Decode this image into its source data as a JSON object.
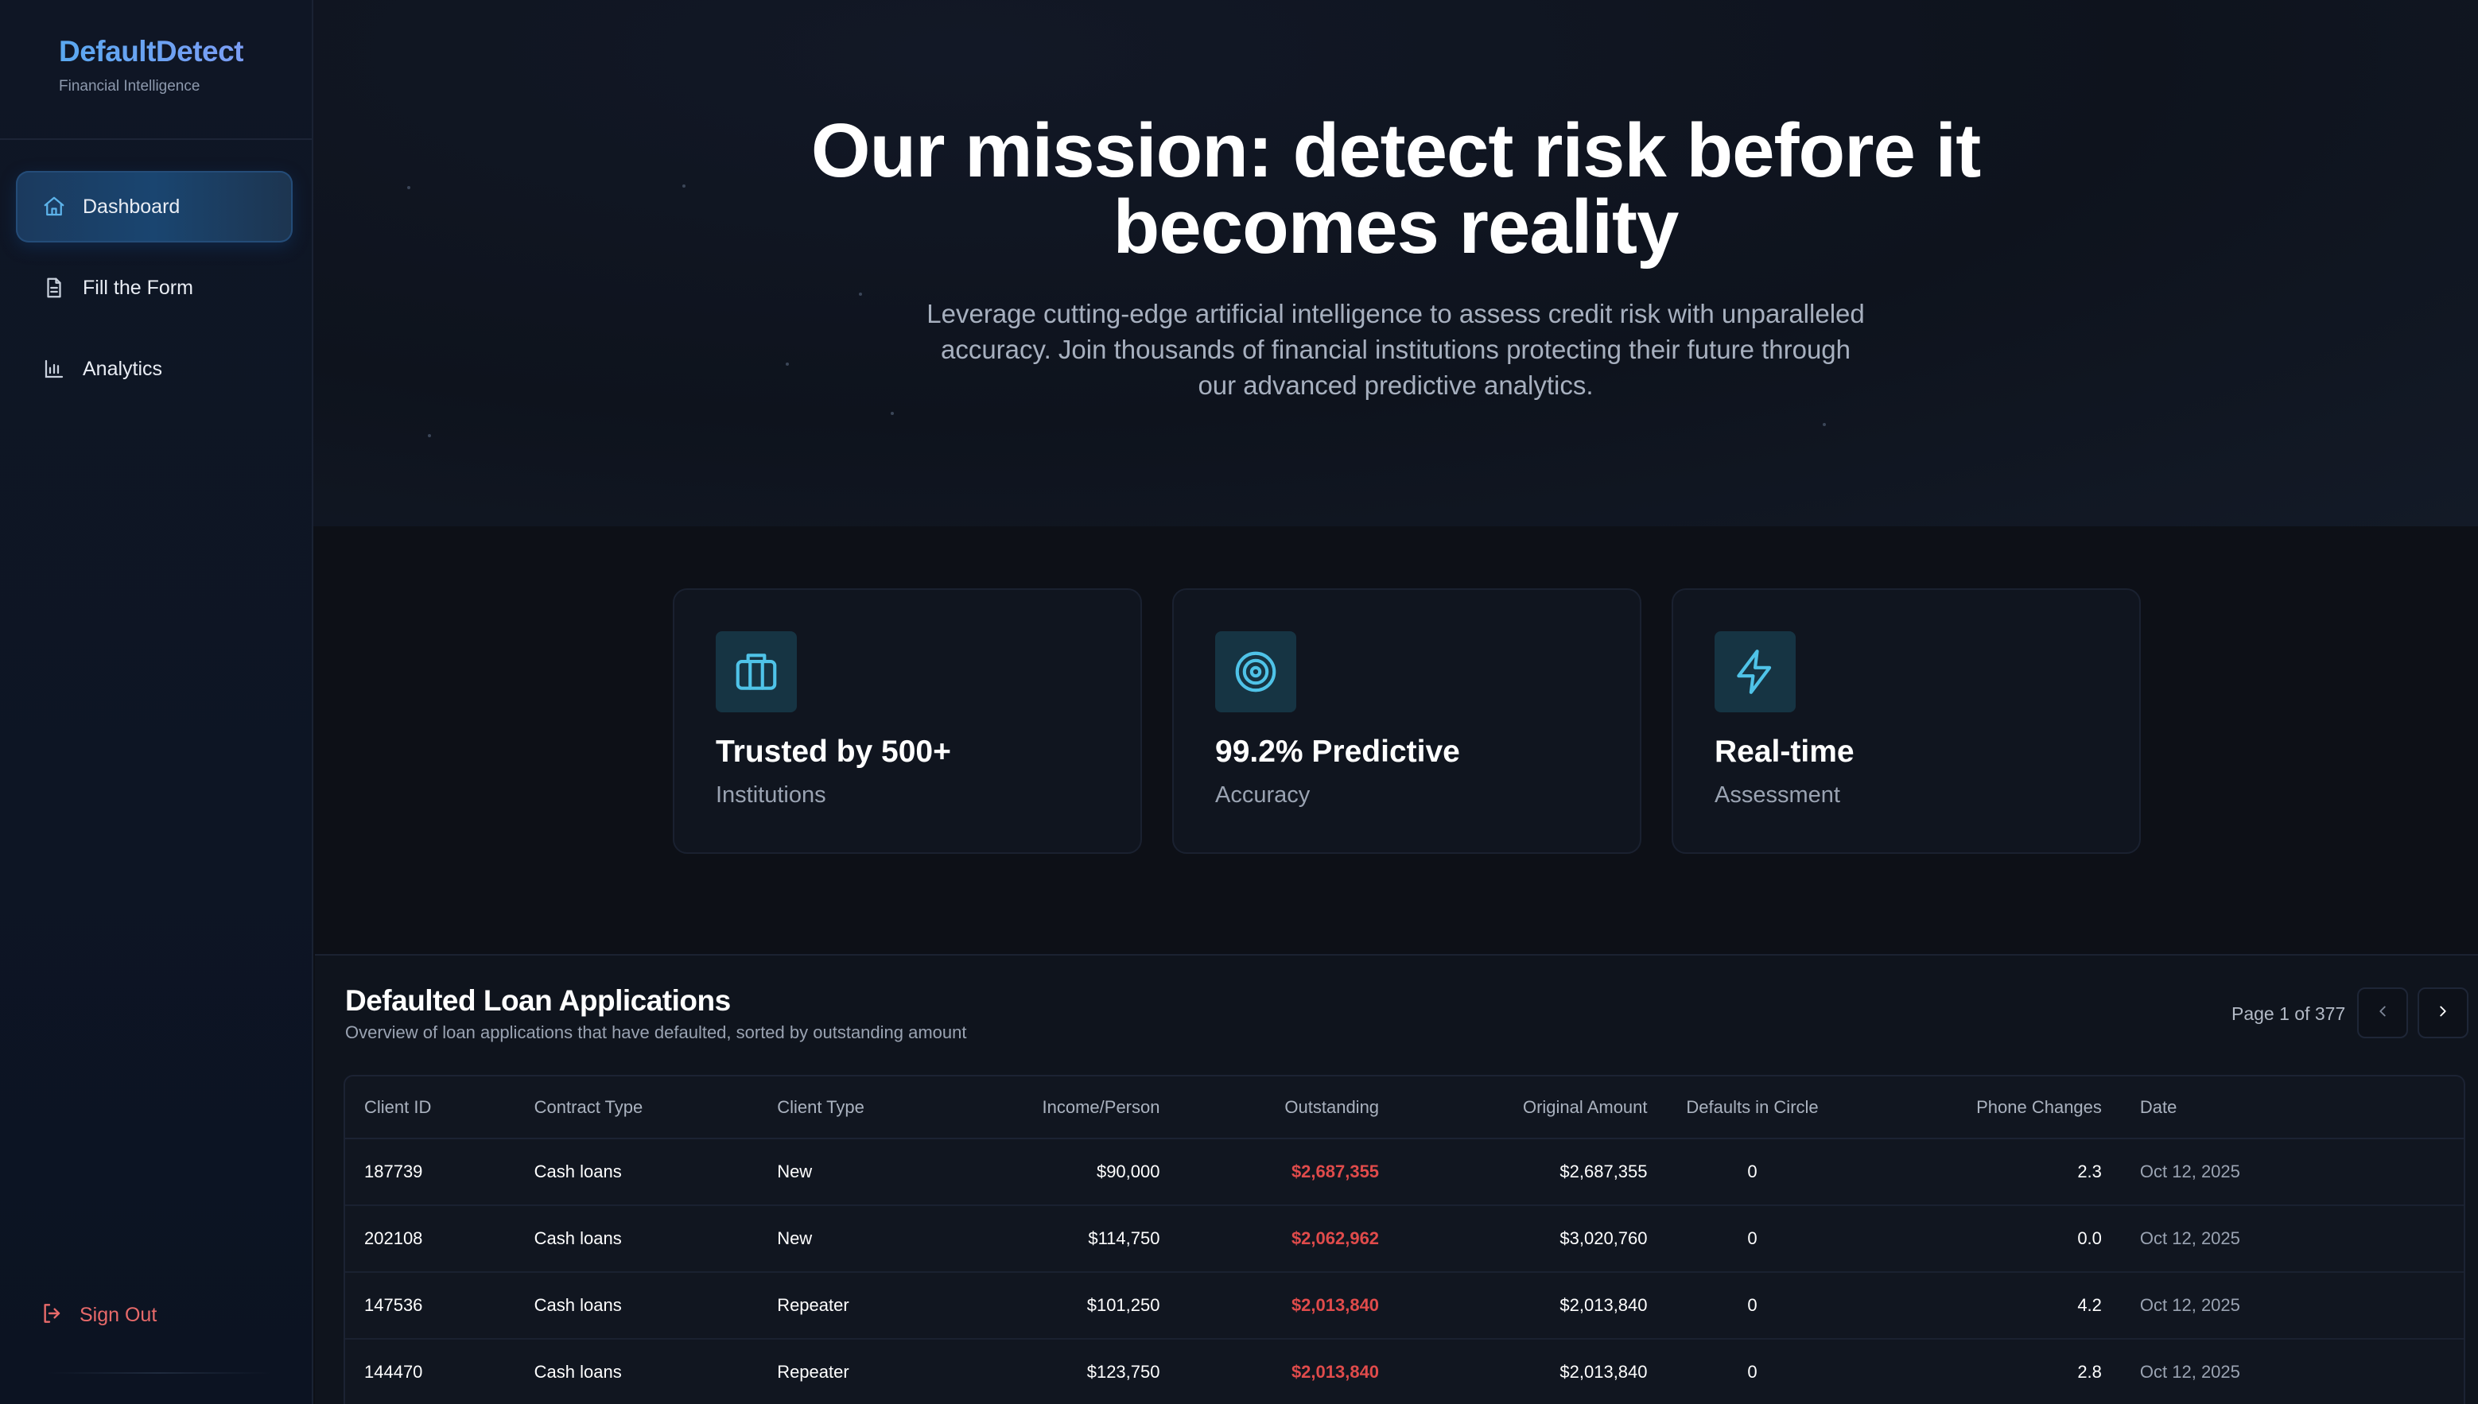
{
  "brand": {
    "title": "DefaultDetect",
    "subtitle": "Financial Intelligence"
  },
  "nav": {
    "items": [
      {
        "label": "Dashboard",
        "icon": "home-icon",
        "active": true
      },
      {
        "label": "Fill the Form",
        "icon": "document-icon",
        "active": false
      },
      {
        "label": "Analytics",
        "icon": "bar-chart-icon",
        "active": false
      }
    ],
    "sign_out": "Sign Out"
  },
  "hero": {
    "title_line1": "Our mission: detect risk before it",
    "title_line2": "becomes reality",
    "subtitle": "Leverage cutting-edge artificial intelligence to assess credit risk with unparalleled accuracy. Join thousands of financial institutions protecting their future through our advanced predictive analytics."
  },
  "features": [
    {
      "icon": "briefcase-icon",
      "title": "Trusted by 500+",
      "subtitle": "Institutions"
    },
    {
      "icon": "target-icon",
      "title": "99.2% Predictive",
      "subtitle": "Accuracy"
    },
    {
      "icon": "lightning-icon",
      "title": "Real-time",
      "subtitle": "Assessment"
    }
  ],
  "table": {
    "title": "Defaulted Loan Applications",
    "subtitle": "Overview of loan applications that have defaulted, sorted by outstanding amount",
    "pager": "Page 1 of 377",
    "columns": [
      "Client ID",
      "Contract Type",
      "Client Type",
      "Income/Person",
      "Outstanding",
      "Original Amount",
      "Defaults in Circle",
      "Phone Changes",
      "Date"
    ],
    "rows": [
      [
        "187739",
        "Cash loans",
        "New",
        "$90,000",
        "$2,687,355",
        "$2,687,355",
        "0",
        "2.3",
        "Oct 12, 2025"
      ],
      [
        "202108",
        "Cash loans",
        "New",
        "$114,750",
        "$2,062,962",
        "$3,020,760",
        "0",
        "0.0",
        "Oct 12, 2025"
      ],
      [
        "147536",
        "Cash loans",
        "Repeater",
        "$101,250",
        "$2,013,840",
        "$2,013,840",
        "0",
        "4.2",
        "Oct 12, 2025"
      ],
      [
        "144470",
        "Cash loans",
        "Repeater",
        "$123,750",
        "$2,013,840",
        "$2,013,840",
        "0",
        "2.8",
        "Oct 12, 2025"
      ]
    ]
  },
  "colors": {
    "accent": "#4fc3e8",
    "danger": "#e04b4b",
    "background": "#0d1017"
  }
}
